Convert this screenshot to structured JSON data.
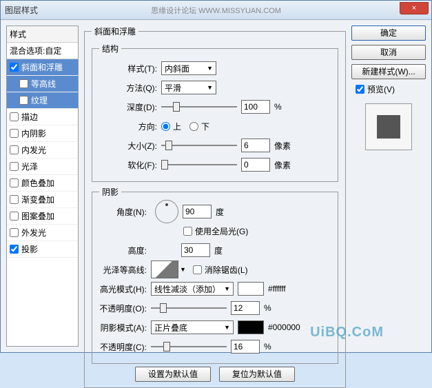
{
  "titlebar": {
    "title": "图层样式",
    "brand": "思缘设计论坛  WWW.MISSYUAN.COM",
    "close": "×"
  },
  "sidebar": {
    "header": "样式",
    "blend": "混合选项:自定",
    "items": [
      {
        "label": "斜面和浮雕",
        "checked": true,
        "selected": true
      },
      {
        "label": "等高线",
        "checked": false,
        "indent": true,
        "selected": true
      },
      {
        "label": "纹理",
        "checked": false,
        "indent": true,
        "selected": true
      },
      {
        "label": "描边",
        "checked": false
      },
      {
        "label": "内阴影",
        "checked": false
      },
      {
        "label": "内发光",
        "checked": false
      },
      {
        "label": "光泽",
        "checked": false
      },
      {
        "label": "颜色叠加",
        "checked": false
      },
      {
        "label": "渐变叠加",
        "checked": false
      },
      {
        "label": "图案叠加",
        "checked": false
      },
      {
        "label": "外发光",
        "checked": false
      },
      {
        "label": "投影",
        "checked": true
      }
    ]
  },
  "bevel": {
    "legend": "斜面和浮雕",
    "struct_legend": "结构",
    "style_label": "样式(T):",
    "style_value": "内斜面",
    "method_label": "方法(Q):",
    "method_value": "平滑",
    "depth_label": "深度(D):",
    "depth_value": "100",
    "depth_unit": "%",
    "dir_label": "方向:",
    "dir_up": "上",
    "dir_down": "下",
    "size_label": "大小(Z):",
    "size_value": "6",
    "size_unit": "像素",
    "soften_label": "软化(F):",
    "soften_value": "0",
    "soften_unit": "像素"
  },
  "shade": {
    "legend": "阴影",
    "angle_label": "角度(N):",
    "angle_value": "90",
    "angle_unit": "度",
    "global_label": "使用全局光(G)",
    "alt_label": "高度:",
    "alt_value": "30",
    "alt_unit": "度",
    "gloss_label": "光泽等高线:",
    "anti_label": "消除锯齿(L)",
    "hi_mode_label": "高光模式(H):",
    "hi_mode_value": "线性减淡（添加）",
    "hi_color": "#ffffff",
    "hi_hex": "#ffffff",
    "hi_op_label": "不透明度(O):",
    "hi_op_value": "12",
    "hi_op_unit": "%",
    "sh_mode_label": "阴影模式(A):",
    "sh_mode_value": "正片叠底",
    "sh_color": "#000000",
    "sh_hex": "#000000",
    "sh_op_label": "不透明度(C):",
    "sh_op_value": "16",
    "sh_op_unit": "%"
  },
  "buttons": {
    "default_set": "设置为默认值",
    "default_reset": "复位为默认值"
  },
  "right": {
    "ok": "确定",
    "cancel": "取消",
    "new_style": "新建样式(W)...",
    "preview_label": "预览(V)"
  },
  "watermark": "UiBQ.CoM"
}
